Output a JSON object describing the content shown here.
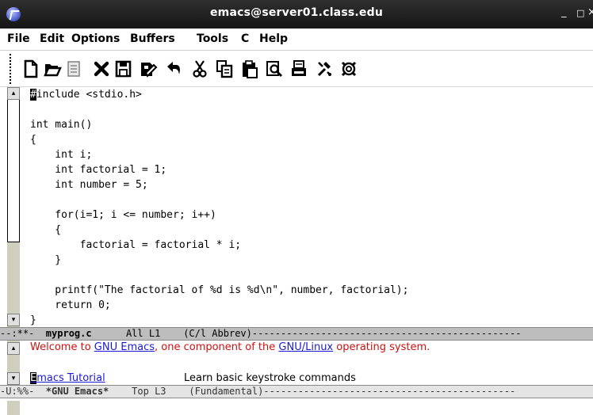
{
  "window": {
    "title": "emacs@server01.class.edu",
    "min_glyph": "_",
    "max_glyph": "□",
    "close_glyph": "×"
  },
  "menu": {
    "items": [
      "File",
      "Edit",
      "Options",
      "Buffers",
      "Tools",
      "C",
      "Help"
    ]
  },
  "toolbar": {
    "icons": [
      "new-file-icon",
      "open-folder-icon",
      "close-buffer-icon",
      "cancel-icon",
      "save-icon",
      "save-as-icon",
      "undo-icon",
      "cut-icon",
      "copy-icon",
      "paste-icon",
      "search-icon",
      "print-icon",
      "preferences-icon",
      "help-icon"
    ]
  },
  "editor": {
    "cursor_char": "#",
    "lines": [
      "include <stdio.h>",
      "",
      "int main()",
      "{",
      "    int i;",
      "    int factorial = 1;",
      "    int number = 5;",
      "",
      "    for(i=1; i <= number; i++)",
      "    {",
      "        factorial = factorial * i;",
      "    }",
      "",
      "    printf(\"The factorial of %d is %d\\n\", number, factorial);",
      "    return 0;",
      "}"
    ]
  },
  "modeline_top": {
    "prefix": "--:**-  ",
    "buffer": "myprog.c",
    "rest": "      All L1    (C/l Abbrev)-----------------------------------------------"
  },
  "welcome": {
    "part1": "Welcome to ",
    "link1": "GNU Emacs",
    "part2": ", one component of the ",
    "link2": "GNU/Linux",
    "part3": " operating system."
  },
  "tutorial": {
    "cursor_char": "E",
    "link_rest": "macs Tutorial",
    "description": "Learn basic keystroke commands"
  },
  "modeline_bottom": {
    "prefix": "-U:%%-  ",
    "buffer": "*GNU Emacs*",
    "rest": "    Top L3    (Fundamental)--------------------------------------------"
  },
  "colors": {
    "titlebar": "#1f1f1f",
    "modeline_active": "#bdbdbd",
    "link": "#1a1ad6",
    "welcome_text": "#cc1010"
  }
}
